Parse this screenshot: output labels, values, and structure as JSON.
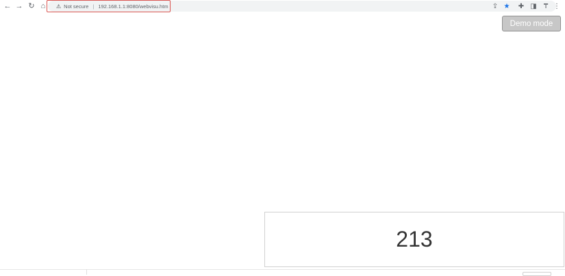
{
  "browser": {
    "nav_icons": {
      "back": "←",
      "forward": "→",
      "reload": "↻",
      "home": "⌂"
    },
    "omnibox": {
      "security_icon": "⚠",
      "security_label": "Not secure",
      "separator": "|",
      "url": "192.168.1.1:8080/webvisu.htm"
    },
    "right_icons": {
      "share": "⇪",
      "bookmark": "★",
      "extensions": "✚",
      "side_panel": "◨",
      "profile": "₸",
      "menu": "⋮"
    },
    "accent_bookmark": "#1a73e8"
  },
  "page": {
    "demo_button_label": "Demo mode",
    "counter_value": "213"
  }
}
